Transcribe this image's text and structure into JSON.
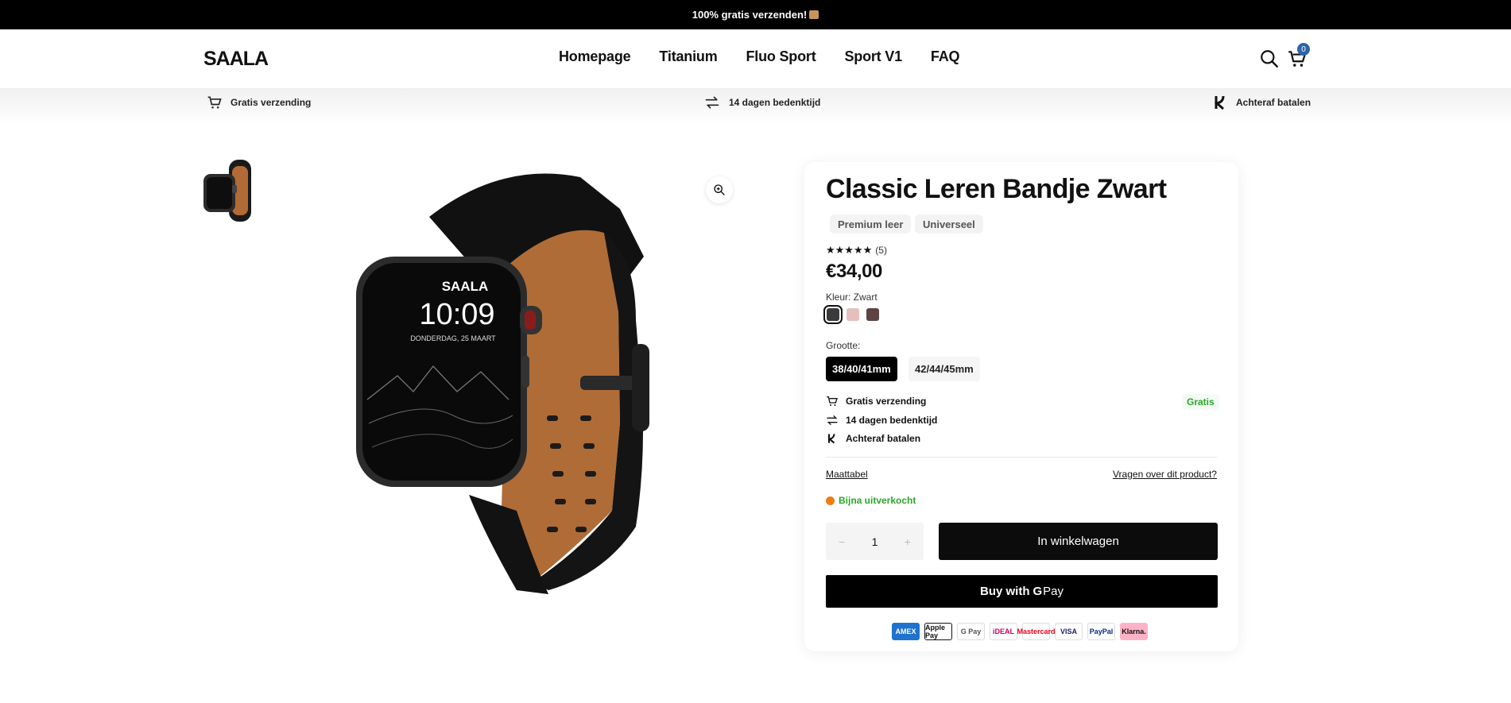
{
  "announcement": {
    "text": "100% gratis verzenden!"
  },
  "header": {
    "logo": "SAALA",
    "nav": [
      "Homepage",
      "Titanium",
      "Fluo Sport",
      "Sport V1",
      "FAQ"
    ],
    "cart_count": "0"
  },
  "usps": [
    "Gratis verzending",
    "14 dagen bedenktijd",
    "Achteraf batalen"
  ],
  "product": {
    "title": "Classic Leren Bandje Zwart",
    "tags": [
      "Premium leer",
      "Universeel"
    ],
    "rating_count": "(5)",
    "price": "€34,00",
    "color_label": "Kleur: Zwart",
    "swatches": [
      "#3a3a3a",
      "#e5bfbb",
      "#5d4342"
    ],
    "size_label": "Grootte:",
    "sizes": [
      "38/40/41mm",
      "42/44/45mm"
    ],
    "perks": [
      "Gratis verzending",
      "14 dagen bedenktijd",
      "Achteraf batalen"
    ],
    "gratis_badge": "Gratis",
    "size_chart_link": "Maattabel",
    "question_link": "Vragen over dit product?",
    "stock_text": "Bijna uitverkocht",
    "quantity": "1",
    "add_to_cart": "In winkelwagen",
    "buy_with": "Buy with",
    "gpay_g": "G",
    "gpay_pay": "Pay",
    "watch_brand": "SAALA",
    "watch_time": "10:09",
    "watch_date": "DONDERDAG, 25 MAART"
  },
  "payments": [
    "AMEX",
    "Apple Pay",
    "G Pay",
    "iDEAL",
    "Mastercard",
    "VISA",
    "PayPal",
    "Klarna."
  ],
  "colors": {
    "accent_green": "#2ba52b",
    "stock_dot": "#f07d12",
    "cart_badge": "#2d64a8"
  }
}
